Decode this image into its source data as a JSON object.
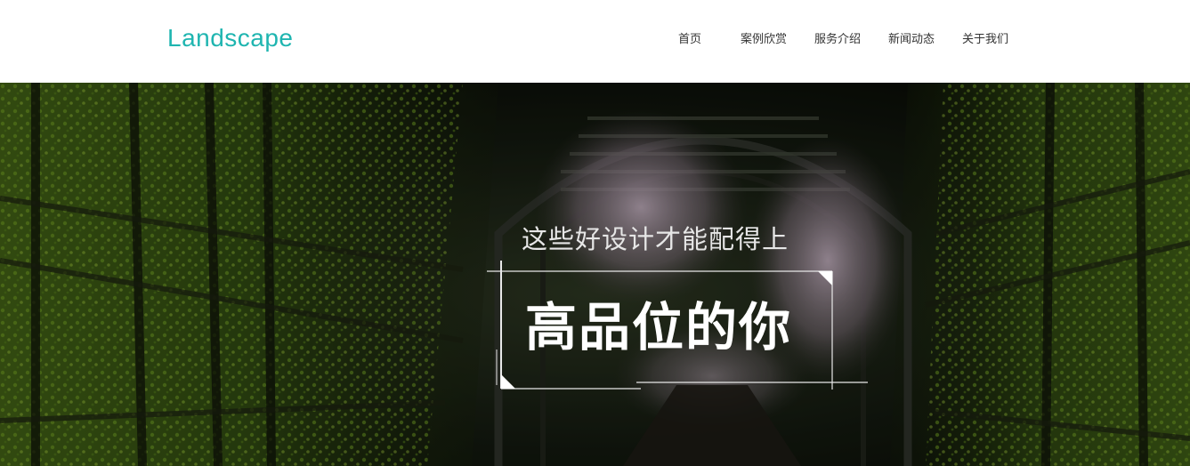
{
  "header": {
    "logo_text": "Landscape",
    "brand_color": "#1fb5b0",
    "nav": {
      "items": [
        {
          "label": "首页"
        },
        {
          "label": "案例欣赏"
        },
        {
          "label": "服务介绍"
        },
        {
          "label": "新闻动态"
        },
        {
          "label": "关于我们"
        }
      ]
    }
  },
  "hero": {
    "subtitle": "这些好设计才能配得上",
    "title": "高品位的你"
  }
}
